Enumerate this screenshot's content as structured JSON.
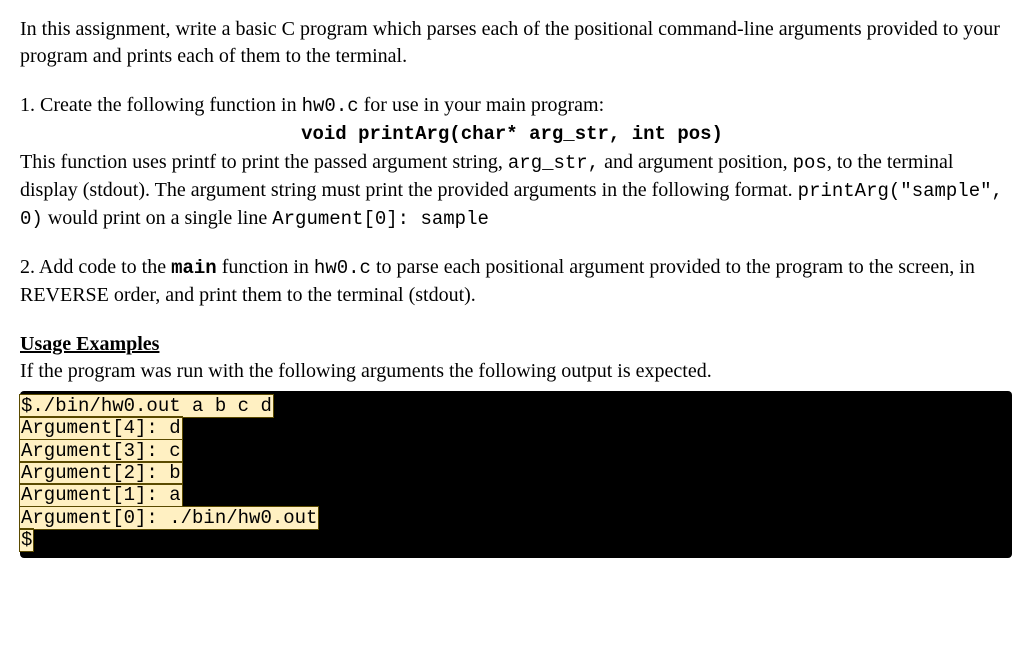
{
  "intro": "In this assignment, write a basic C program which parses each of the positional command-line arguments provided to your program and prints each of them to the terminal.",
  "step1": {
    "lead_a": "1. Create the following function in ",
    "file": "hw0.c",
    "lead_b": " for use in your main program:",
    "signature": "void printArg(char* arg_str, int pos)",
    "desc_a": "This function uses printf to print the passed argument string, ",
    "arg_str": "arg_str,",
    "desc_b": " and argument position, ",
    "pos_code": "pos",
    "desc_c": ", to the terminal display (stdout). The argument string must print the provided arguments in the following format. ",
    "example_call": "printArg(\"sample\", 0)",
    "desc_d": " would print on a single line ",
    "example_output": "Argument[0]: sample"
  },
  "step2": {
    "lead_a": "2. Add code to the ",
    "main_word": "main",
    "lead_b": " function in ",
    "file": "hw0.c",
    "lead_c": " to parse each positional argument provided to the program to the screen, in REVERSE order, and print them to the terminal (stdout)."
  },
  "usage_heading": "Usage Examples",
  "usage_intro": "If the program was run with the following arguments the following output is expected.",
  "terminal": {
    "lines": [
      "$./bin/hw0.out a b c d",
      "Argument[4]: d",
      "Argument[3]: c",
      "Argument[2]: b",
      "Argument[1]: a",
      "Argument[0]: ./bin/hw0.out",
      "$"
    ]
  }
}
